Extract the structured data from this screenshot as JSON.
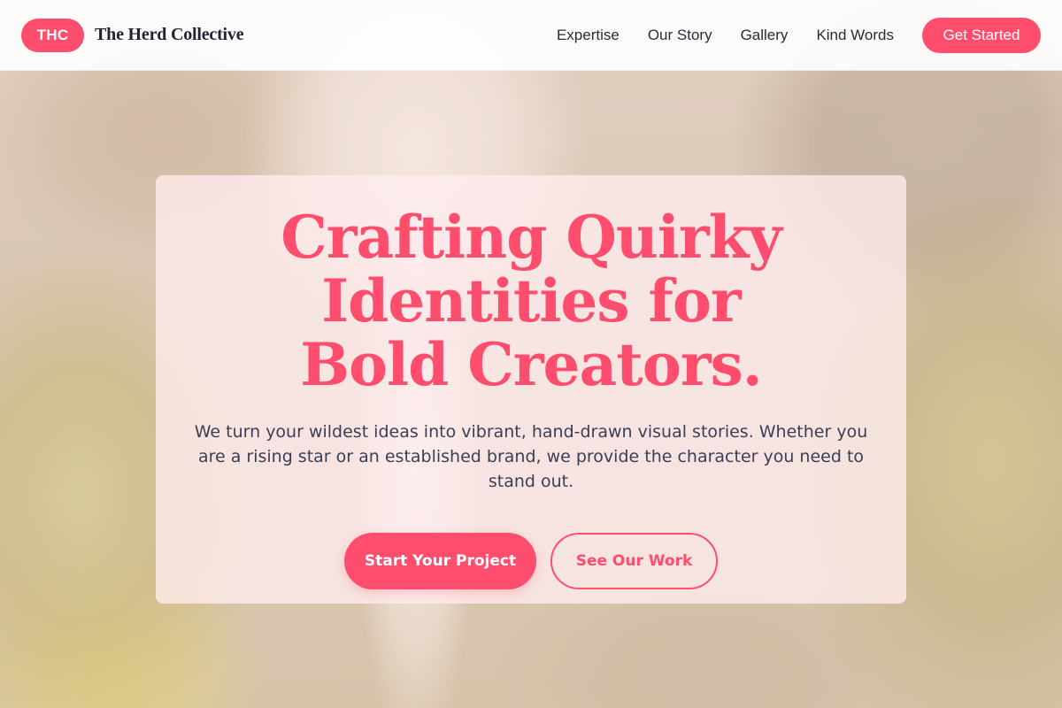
{
  "header": {
    "logo_badge": "THC",
    "brand_name": "The Herd Collective",
    "nav": [
      {
        "label": "Expertise"
      },
      {
        "label": "Our Story"
      },
      {
        "label": "Gallery"
      },
      {
        "label": "Kind Words"
      }
    ],
    "cta_label": "Get Started"
  },
  "hero": {
    "title": "Crafting Quirky Identities for Bold Creators.",
    "subtitle": "We turn your wildest ideas into vibrant, hand-drawn visual stories. Whether you are a rising star or an established brand, we provide the character you need to stand out.",
    "primary_button": "Start Your Project",
    "secondary_button": "See Our Work"
  },
  "colors": {
    "accent": "#ff4d6d",
    "text_dark": "#2a2a3a",
    "text_body": "#3a3f55",
    "card_background": "#ffedf0"
  }
}
